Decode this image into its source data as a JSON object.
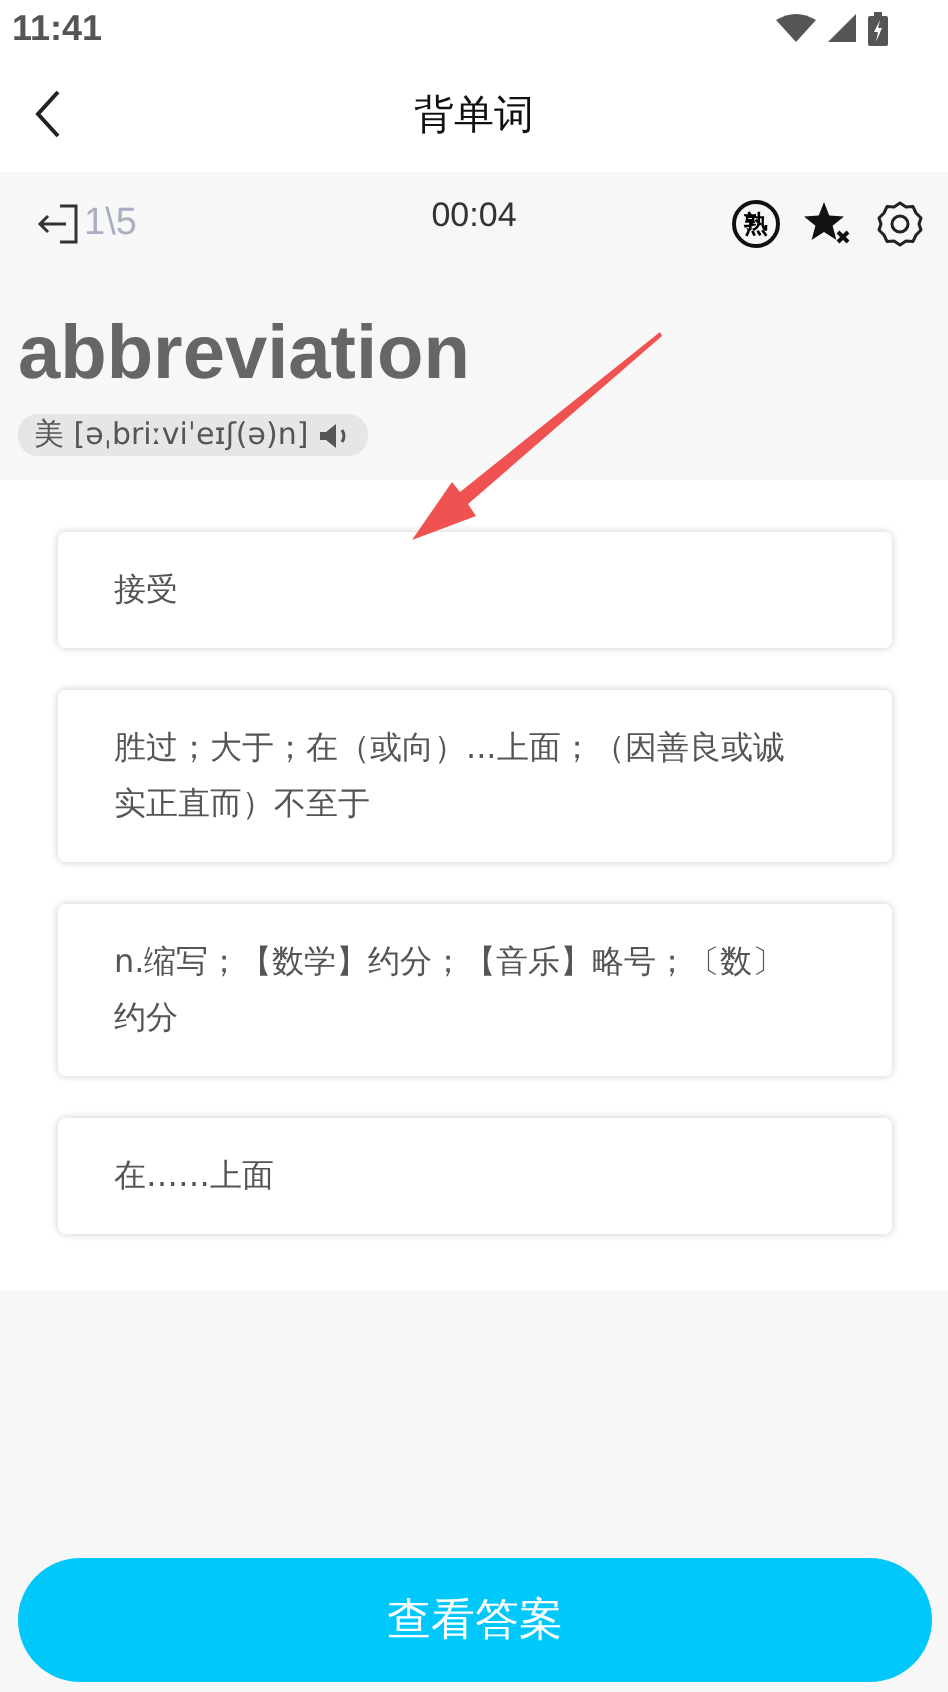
{
  "status_bar": {
    "time": "11:41"
  },
  "header": {
    "title": "背单词"
  },
  "toolbar": {
    "progress": "1\\5",
    "timer": "00:04",
    "familiar_label": "熟"
  },
  "word": {
    "text": "abbreviation",
    "phonetic": "美 [əˌbriːviˈeɪʃ(ə)n]"
  },
  "options": [
    {
      "text": "接受"
    },
    {
      "text": "胜过；大于；在（或向）...上面；（因善良或诚实正直而）不至于"
    },
    {
      "text": "n.缩写；【数学】约分；【音乐】略号；〔数〕约分"
    },
    {
      "text": "在……上面"
    }
  ],
  "action_button": {
    "label": "查看答案"
  }
}
